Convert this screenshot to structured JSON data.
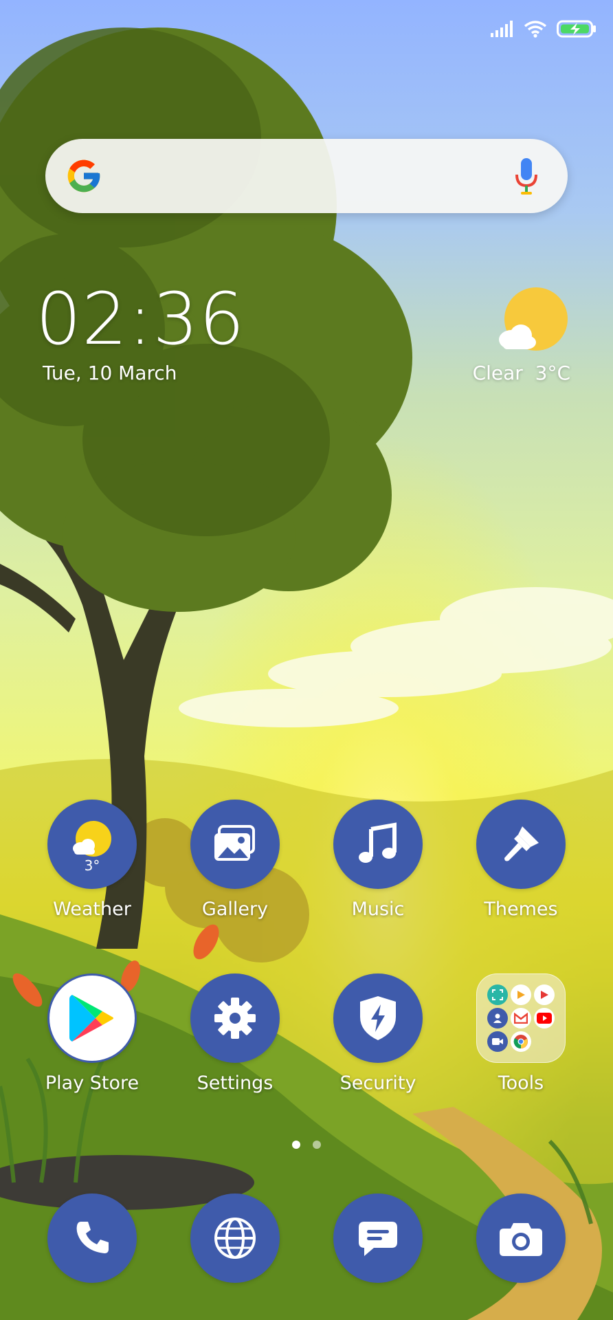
{
  "status_bar": {
    "icons": [
      "signal-icon",
      "wifi-icon",
      "battery-charging-icon"
    ]
  },
  "search": {
    "logo": "google-g-icon",
    "voice": "microphone-icon"
  },
  "clock": {
    "time": "02:36",
    "date": "Tue, 10 March"
  },
  "weather_widget": {
    "condition": "Clear",
    "temperature": "3°C",
    "icon": "sun-cloud-icon"
  },
  "apps": [
    {
      "label": "Weather",
      "icon": "weather-icon",
      "badge": "3°"
    },
    {
      "label": "Gallery",
      "icon": "gallery-icon"
    },
    {
      "label": "Music",
      "icon": "music-note-icon"
    },
    {
      "label": "Themes",
      "icon": "paintbrush-icon"
    },
    {
      "label": "Play Store",
      "icon": "play-store-icon"
    },
    {
      "label": "Settings",
      "icon": "gear-icon"
    },
    {
      "label": "Security",
      "icon": "shield-lightning-icon"
    },
    {
      "label": "Tools",
      "icon": "folder-icon"
    }
  ],
  "pager": {
    "pages": 2,
    "current": 1
  },
  "dock": [
    {
      "icon": "phone-icon"
    },
    {
      "icon": "browser-globe-icon"
    },
    {
      "icon": "messages-icon"
    },
    {
      "icon": "camera-icon"
    }
  ],
  "colors": {
    "app_icon_bg": "#3f5bab",
    "sky_top": "#93b4ff",
    "sun_yellow": "#f7c93c"
  }
}
